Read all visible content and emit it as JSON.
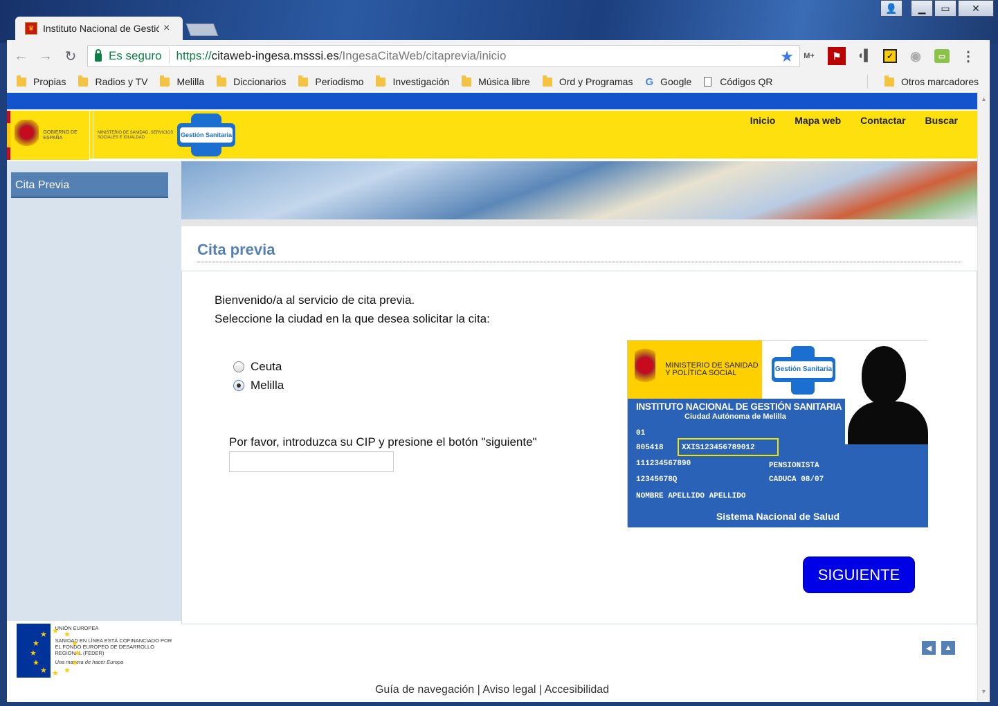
{
  "browser": {
    "tab_title": "Instituto Nacional de Gestión Sanitaria",
    "tab_close": "×",
    "secure_label": "Es seguro",
    "url_scheme": "https://",
    "url_host": "citaweb-ingesa.msssi.es",
    "url_path": "/IngesaCitaWeb/citaprevia/inicio",
    "bookmarks": [
      {
        "label": "Propias",
        "icon": "folder-icon"
      },
      {
        "label": "Radios y TV",
        "icon": "folder-icon"
      },
      {
        "label": "Melilla",
        "icon": "folder-icon"
      },
      {
        "label": "Diccionarios",
        "icon": "folder-icon"
      },
      {
        "label": "Periodismo",
        "icon": "folder-icon"
      },
      {
        "label": "Investigación",
        "icon": "folder-icon"
      },
      {
        "label": "Música libre",
        "icon": "folder-icon"
      },
      {
        "label": "Ord y Programas",
        "icon": "folder-icon"
      },
      {
        "label": "Google",
        "icon": "google-icon"
      },
      {
        "label": "Códigos QR",
        "icon": "document-icon"
      }
    ],
    "other_bookmarks": "Otros marcadores"
  },
  "header": {
    "nav": [
      "Inicio",
      "Mapa web",
      "Contactar",
      "Buscar"
    ],
    "gov_text": "Gobierno de España",
    "ministry_text": "Ministerio de Sanidad, Servicios Sociales e Igualdad",
    "ingesa_text": "Gestión Sanitaria"
  },
  "sidebar": {
    "items": [
      {
        "label": "Cita Previa"
      }
    ],
    "eu_title": "Unión Europea",
    "eu_body": "Sanidad en línea está cofinanciado por el Fondo Europeo de Desarrollo Regional (FEDER)",
    "eu_slogan": "Una manera de hacer Europa"
  },
  "main": {
    "title": "Cita previa",
    "welcome_line1": "Bienvenido/a al servicio de cita previa.",
    "welcome_line2": "Seleccione la ciudad en la que desea solicitar la cita:",
    "cities": [
      {
        "label": "Ceuta",
        "checked": false
      },
      {
        "label": "Melilla",
        "checked": true
      }
    ],
    "cip_label": "Por favor, introduzca su CIP y presione el botón \"siguiente\"",
    "cip_value": "",
    "next_label": "SIGUIENTE"
  },
  "card": {
    "ministry": "Ministerio de Sanidad y Política Social",
    "ingesa": "Gestión Sanitaria",
    "institute": "INSTITUTO NACIONAL DE GESTIÓN SANITARIA",
    "ciudad": "Ciudad Autónoma de Melilla",
    "line_01": "01",
    "line_code": "805418",
    "cip_code": "XXIS123456789012",
    "line_num1": "111234567890",
    "line_num2": "12345678Q",
    "pensionista": "PENSIONISTA",
    "caduca": "CADUCA 08/07",
    "name": "NOMBRE APELLIDO APELLIDO",
    "footer": "Sistema Nacional de Salud"
  },
  "footer": {
    "links": [
      "Guía de navegación",
      "Aviso legal",
      "Accesibilidad"
    ],
    "separator": " | "
  },
  "colors": {
    "header_yellow": "#ffe00f",
    "top_blue": "#1353cc",
    "sidebar_bg": "#d9e3ee",
    "accent_blue": "#5480b3",
    "button_blue": "#0000e6"
  }
}
